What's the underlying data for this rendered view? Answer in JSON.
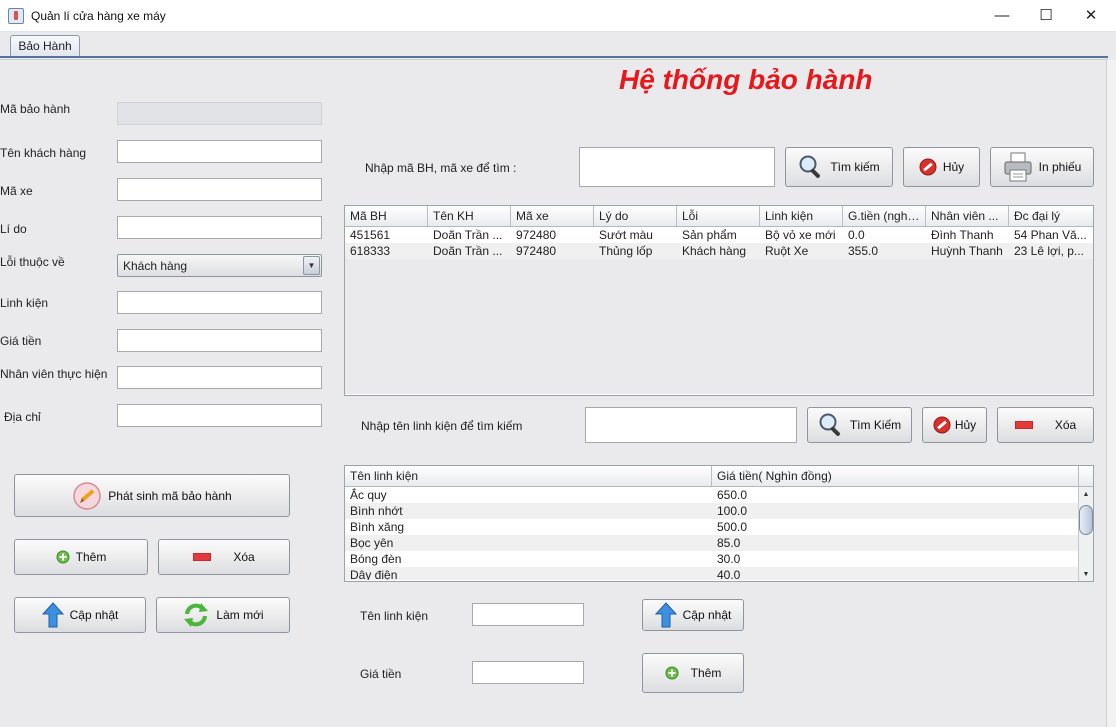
{
  "window": {
    "title": "Quản lí cửa hàng xe máy",
    "controls": {
      "minimize": "—",
      "maximize": "☐",
      "close": "✕"
    }
  },
  "tab": {
    "label": "Bảo Hành"
  },
  "heading": "Hệ thống bảo hành",
  "form": {
    "ma_bao_hanh_label": "Mã bảo hành",
    "ten_khach_hang_label": "Tên khách hàng",
    "ma_xe_label": "Mã xe",
    "li_do_label": "Lí do",
    "loi_thuoc_ve_label": "Lỗi thuộc về",
    "loi_thuoc_ve_value": "Khách hàng",
    "linh_kien_label": "Linh kiện",
    "gia_tien_label": "Giá tiền",
    "nhan_vien_label": "Nhân viên thực hiện",
    "dia_chi_label": "Địa chỉ",
    "values": {
      "ma_bao_hanh": "",
      "ten_khach_hang": "",
      "ma_xe": "",
      "li_do": "",
      "linh_kien": "",
      "gia_tien": "",
      "nhan_vien": "",
      "dia_chi": ""
    }
  },
  "left_buttons": {
    "generate": "Phát sinh mã bảo hành",
    "add": "Thêm",
    "delete": "Xóa",
    "update": "Cập nhật",
    "refresh": "Làm mới"
  },
  "search_warranty": {
    "label": "Nhập mã BH, mã xe để tìm :",
    "value": "",
    "search_button": "Tìm kiếm",
    "cancel_button": "Hủy",
    "print_button": "In phiếu"
  },
  "warranty_table": {
    "columns": [
      "Mã BH",
      "Tên KH",
      "Mã xe",
      "Lý do",
      "Lỗi",
      "Linh kiện",
      "G.tiền (nghì...",
      "Nhân viên ...",
      "Đc đại lý"
    ],
    "rows": [
      [
        "451561",
        "Doãn Trần ...",
        "972480",
        "Sướt màu",
        "Sản phẩm",
        "Bộ vỏ xe mới",
        "0.0",
        "Đình Thanh",
        "54 Phan Vă..."
      ],
      [
        "618333",
        "Doãn Trần ...",
        "972480",
        "Thủng lốp",
        "Khách hàng",
        "Ruột Xe",
        "355.0",
        "Huỳnh Thanh",
        "23 Lê lợi, p..."
      ]
    ]
  },
  "search_parts": {
    "label": "Nhập tên linh kiện để tìm kiếm",
    "value": "",
    "search_button": "Tìm Kiếm",
    "cancel_button": "Hủy",
    "delete_button": "Xóa"
  },
  "parts_table": {
    "columns": [
      "Tên linh kiện",
      "Giá tiền( Nghìn đồng)"
    ],
    "rows": [
      [
        "Ắc quy",
        "650.0"
      ],
      [
        "Bình nhớt",
        "100.0"
      ],
      [
        "Bình xăng",
        "500.0"
      ],
      [
        "Bọc yên",
        "85.0"
      ],
      [
        "Bóng đèn",
        "30.0"
      ],
      [
        "Dây điện",
        "40.0"
      ]
    ]
  },
  "parts_form": {
    "name_label": "Tên linh kiện",
    "price_label": "Giá tiền",
    "name_value": "",
    "price_value": "",
    "update_button": "Cập nhật",
    "add_button": "Thêm"
  }
}
